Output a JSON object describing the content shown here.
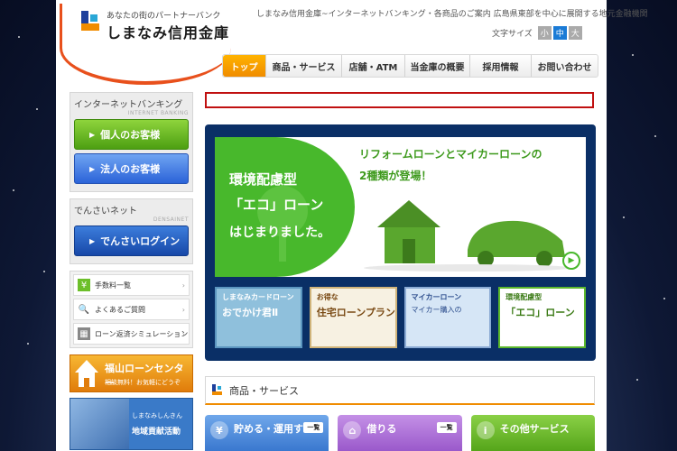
{
  "header": {
    "tagline": "あなたの街のパートナーバンク",
    "bank_name": "しまなみ信用金庫",
    "description": "しまなみ信用金庫~インターネットバンキング・各商品のご案内 広島県東部を中心に展開する地元金融機関",
    "font_size_label": "文字サイズ",
    "font_sizes": [
      "小",
      "中",
      "大"
    ]
  },
  "gnav": [
    "トップ",
    "商品・サービス",
    "店舗・ATM",
    "当金庫の概要",
    "採用情報",
    "お問い合わせ"
  ],
  "left": {
    "ib_title": "インターネットバンキング",
    "ib_sub": "INTERNET BANKING",
    "ib_personal": "個人のお客様",
    "ib_corporate": "法人のお客様",
    "densai_title": "でんさいネット",
    "densai_sub": "DENSAINET",
    "densai_login": "でんさいログイン",
    "links": [
      {
        "icon": "¥",
        "label": "手数料一覧"
      },
      {
        "icon": "🔍",
        "label": "よくあるご質問"
      },
      {
        "icon": "▦",
        "label": "ローン返済シミュレーション"
      }
    ],
    "fukuyama_title": "福山ローンセンター",
    "fukuyama_sub": "相談無料！お気軽にどうぞ",
    "chiiki_sub": "しまなみしんきん",
    "chiiki_title": "地域貢献活動"
  },
  "hero": {
    "l1": "環境配慮型",
    "l2": "「エコ」ローン",
    "l3": "はじまりました。",
    "r1": "リフォームローンとマイカーローンの",
    "r2": "2種類が登場！"
  },
  "thumbs": [
    {
      "title": "しまなみカードローン",
      "sub": "おでかけ君Ⅱ"
    },
    {
      "title": "お得な",
      "sub": "住宅ローンプラン"
    },
    {
      "title": "マイカーローン",
      "sub": "マイカー購入の"
    },
    {
      "title": "環境配慮型",
      "sub": "「エコ」ローン"
    }
  ],
  "section": {
    "title": "商品・サービス"
  },
  "categories": [
    {
      "label": "貯める・運用する",
      "more": "一覧"
    },
    {
      "label": "借りる",
      "more": "一覧"
    },
    {
      "label": "その他サービス",
      "more": ""
    }
  ]
}
